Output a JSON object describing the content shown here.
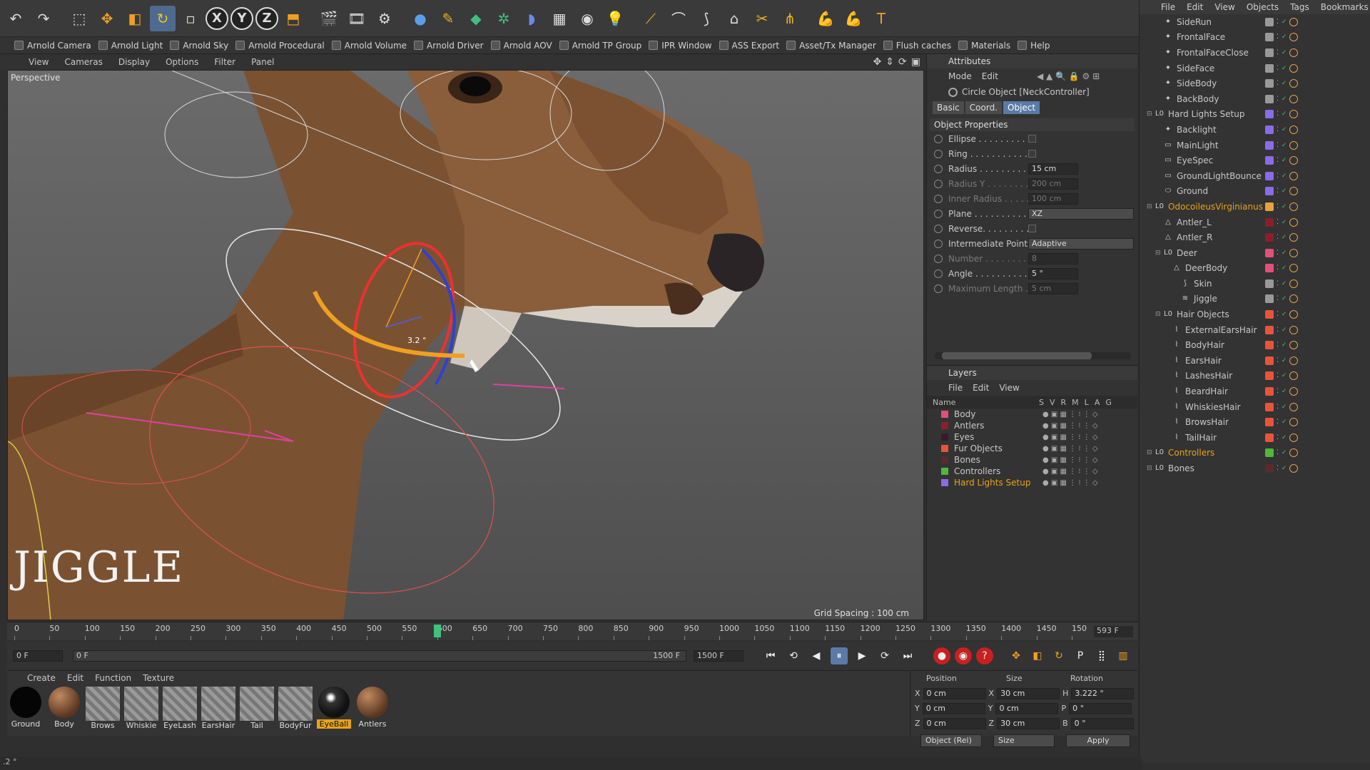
{
  "toolbar": {
    "axes": [
      "X",
      "Y",
      "Z"
    ]
  },
  "arnold_bar": [
    "Arnold Camera",
    "Arnold Light",
    "Arnold Sky",
    "Arnold Procedural",
    "Arnold Volume",
    "Arnold Driver",
    "Arnold AOV",
    "Arnold TP Group",
    "IPR Window",
    "ASS Export",
    "Asset/Tx Manager",
    "Flush caches",
    "Materials",
    "Help"
  ],
  "viewport": {
    "menu": [
      "View",
      "Cameras",
      "Display",
      "Options",
      "Filter",
      "Panel"
    ],
    "label": "Perspective",
    "overlay_title": "JIGGLE",
    "grid_spacing": "Grid Spacing : 100 cm",
    "angle_readout": "3.2 °"
  },
  "attributes": {
    "title": "Attributes",
    "menu": [
      "Mode",
      "Edit"
    ],
    "object": "Circle Object [NeckController]",
    "tabs": [
      "Basic",
      "Coord.",
      "Object"
    ],
    "active_tab": "Object",
    "section": "Object Properties",
    "props": [
      {
        "label": "Ellipse . . . . . . . . . . .",
        "type": "check",
        "value": ""
      },
      {
        "label": "Ring . . . . . . . . . . . . .",
        "type": "check",
        "value": ""
      },
      {
        "label": "Radius . . . . . . . . . . .",
        "type": "field",
        "value": "15 cm"
      },
      {
        "label": "Radius Y . . . . . . . . . .",
        "type": "field",
        "value": "200 cm",
        "disabled": true
      },
      {
        "label": "Inner Radius . . . . . . .",
        "type": "field",
        "value": "100 cm",
        "disabled": true
      },
      {
        "label": "Plane . . . . . . . . . . . .",
        "type": "dropdown",
        "value": "XZ"
      },
      {
        "label": "Reverse. . . . . . . . . . .",
        "type": "check",
        "value": ""
      },
      {
        "label": "Intermediate Points",
        "type": "dropdown",
        "value": "Adaptive"
      },
      {
        "label": "Number . . . . . . . . . . .",
        "type": "field",
        "value": "8",
        "disabled": true
      },
      {
        "label": "Angle . . . . . . . . . . . .",
        "type": "field",
        "value": "5 °"
      },
      {
        "label": "Maximum Length . .",
        "type": "field",
        "value": "5 cm",
        "disabled": true
      }
    ]
  },
  "layers": {
    "title": "Layers",
    "menu": [
      "File",
      "Edit",
      "View"
    ],
    "columns": [
      "Name",
      "S",
      "V",
      "R",
      "M",
      "L",
      "A",
      "G"
    ],
    "rows": [
      {
        "name": "Body",
        "color": "#e0507a"
      },
      {
        "name": "Antlers",
        "color": "#8a1f2a"
      },
      {
        "name": "Eyes",
        "color": "#3b1a2a"
      },
      {
        "name": "Fur Objects",
        "color": "#e8543a"
      },
      {
        "name": "Bones",
        "color": "#5a2b2b"
      },
      {
        "name": "Controllers",
        "color": "#4fb83a"
      },
      {
        "name": "Hard Lights Setup",
        "color": "#8a6be8",
        "highlight": true
      }
    ]
  },
  "object_manager": {
    "menu": [
      "File",
      "Edit",
      "View",
      "Objects",
      "Tags",
      "Bookmarks"
    ],
    "rows": [
      {
        "name": "SideRun",
        "indent": 1,
        "icon": "light-icon",
        "color": "#999"
      },
      {
        "name": "FrontalFace",
        "indent": 1,
        "icon": "light-icon",
        "color": "#999"
      },
      {
        "name": "FrontalFaceClose",
        "indent": 1,
        "icon": "light-icon",
        "color": "#999"
      },
      {
        "name": "SideFace",
        "indent": 1,
        "icon": "light-icon",
        "color": "#999"
      },
      {
        "name": "SideBody",
        "indent": 1,
        "icon": "light-icon",
        "color": "#999"
      },
      {
        "name": "BackBody",
        "indent": 1,
        "icon": "light-icon",
        "color": "#999"
      },
      {
        "name": "Hard Lights Setup",
        "indent": 0,
        "icon": "null-icon",
        "color": "#8a6be8"
      },
      {
        "name": "Backlight",
        "indent": 1,
        "icon": "light-icon",
        "color": "#8a6be8"
      },
      {
        "name": "MainLight",
        "indent": 1,
        "icon": "area-light-icon",
        "color": "#8a6be8"
      },
      {
        "name": "EyeSpec",
        "indent": 1,
        "icon": "area-light-icon",
        "color": "#8a6be8"
      },
      {
        "name": "GroundLightBounce",
        "indent": 1,
        "icon": "area-light-icon",
        "color": "#8a6be8"
      },
      {
        "name": "Ground",
        "indent": 1,
        "icon": "plane-icon",
        "color": "#8a6be8"
      },
      {
        "name": "OdocoileusVirginianus",
        "indent": 0,
        "icon": "null-icon",
        "color": "#e8a040",
        "highlight": true
      },
      {
        "name": "Antler_L",
        "indent": 1,
        "icon": "polygon-icon",
        "color": "#8a1f2a"
      },
      {
        "name": "Antler_R",
        "indent": 1,
        "icon": "polygon-icon",
        "color": "#8a1f2a"
      },
      {
        "name": "Deer",
        "indent": 1,
        "icon": "null-icon",
        "color": "#e0507a"
      },
      {
        "name": "DeerBody",
        "indent": 2,
        "icon": "polygon-icon",
        "color": "#e0507a"
      },
      {
        "name": "Skin",
        "indent": 3,
        "icon": "skin-icon",
        "color": "#999"
      },
      {
        "name": "Jiggle",
        "indent": 3,
        "icon": "jiggle-icon",
        "color": "#999"
      },
      {
        "name": "Hair Objects",
        "indent": 1,
        "icon": "null-icon",
        "color": "#e8543a"
      },
      {
        "name": "ExternalEarsHair",
        "indent": 2,
        "icon": "hair-icon",
        "color": "#e8543a"
      },
      {
        "name": "BodyHair",
        "indent": 2,
        "icon": "hair-icon",
        "color": "#e8543a"
      },
      {
        "name": "EarsHair",
        "indent": 2,
        "icon": "hair-icon",
        "color": "#e8543a"
      },
      {
        "name": "LashesHair",
        "indent": 2,
        "icon": "hair-icon",
        "color": "#e8543a"
      },
      {
        "name": "BeardHair",
        "indent": 2,
        "icon": "hair-icon",
        "color": "#e8543a"
      },
      {
        "name": "WhiskiesHair",
        "indent": 2,
        "icon": "hair-icon",
        "color": "#e8543a"
      },
      {
        "name": "BrowsHair",
        "indent": 2,
        "icon": "hair-icon",
        "color": "#e8543a"
      },
      {
        "name": "TailHair",
        "indent": 2,
        "icon": "hair-icon",
        "color": "#e8543a"
      },
      {
        "name": "Controllers",
        "indent": 0,
        "icon": "null-icon",
        "color": "#4fb83a",
        "highlight": true
      },
      {
        "name": "Bones",
        "indent": 0,
        "icon": "null-icon",
        "color": "#5a2b2b"
      }
    ]
  },
  "timeline": {
    "ticks": [
      "0",
      "50",
      "100",
      "150",
      "200",
      "250",
      "300",
      "350",
      "400",
      "450",
      "500",
      "550",
      "600",
      "650",
      "700",
      "750",
      "800",
      "850",
      "900",
      "950",
      "1000",
      "1050",
      "1100",
      "1150",
      "1200",
      "1250",
      "1300",
      "1350",
      "1400",
      "1450",
      "150"
    ],
    "current_frame": "593 F",
    "start": "0 F",
    "range_start": "0 F",
    "range_end": "1500 F",
    "end": "1500 F"
  },
  "materials": {
    "menu": [
      "Create",
      "Edit",
      "Function",
      "Texture"
    ],
    "items": [
      {
        "name": "Ground",
        "kind": "black"
      },
      {
        "name": "Body",
        "kind": "brown"
      },
      {
        "name": "Brows",
        "kind": "hatch"
      },
      {
        "name": "Whiskie",
        "kind": "hatch"
      },
      {
        "name": "EyeLash",
        "kind": "hatch"
      },
      {
        "name": "EarsHair",
        "kind": "hatch"
      },
      {
        "name": "Tail",
        "kind": "hatch"
      },
      {
        "name": "BodyFur",
        "kind": "hatch"
      },
      {
        "name": "EyeBall",
        "kind": "eye",
        "selected": true
      },
      {
        "name": "Antlers",
        "kind": "brown"
      }
    ]
  },
  "coordinates": {
    "headers": [
      "Position",
      "Size",
      "Rotation"
    ],
    "rows": [
      {
        "axis": "X",
        "pos": "0 cm",
        "size_axis": "X",
        "size": "30 cm",
        "rot_axis": "H",
        "rot": "3.222 °"
      },
      {
        "axis": "Y",
        "pos": "0 cm",
        "size_axis": "Y",
        "size": "0 cm",
        "rot_axis": "P",
        "rot": "0 °"
      },
      {
        "axis": "Z",
        "pos": "0 cm",
        "size_axis": "Z",
        "size": "30 cm",
        "rot_axis": "B",
        "rot": "0 °"
      }
    ],
    "mode": "Object (Rel)",
    "size_mode": "Size",
    "apply": "Apply"
  },
  "status": ".2 °"
}
